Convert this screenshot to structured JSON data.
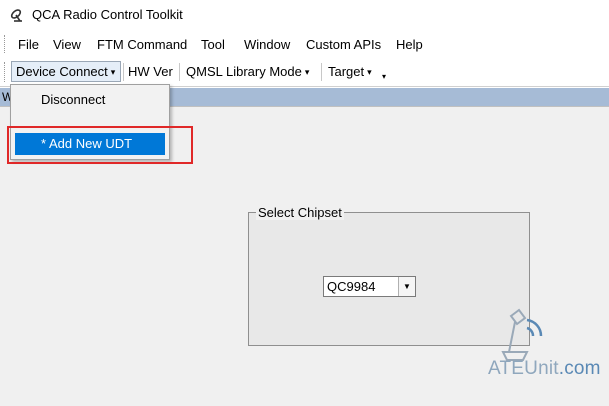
{
  "window": {
    "title": "QCA Radio Control Toolkit",
    "icon": "satellite-dish-icon"
  },
  "menubar": {
    "items": [
      "File",
      "View",
      "FTM Command",
      "Tool",
      "Window",
      "Custom APIs",
      "Help"
    ]
  },
  "toolbar": {
    "device_connect": "Device Connect",
    "hw_ver": "HW Ver",
    "qmsl_library_mode": "QMSL Library Mode",
    "target": "Target",
    "dropdown_arrow": "▾",
    "overflow_arrow": "▾"
  },
  "mdi": {
    "child_title_fragment": "W"
  },
  "device_menu": {
    "items": [
      {
        "label": "Disconnect",
        "highlighted": false
      },
      {
        "label": "* Add New UDT",
        "highlighted": true
      }
    ]
  },
  "chipset": {
    "group_label": "Select Chipset",
    "selected": "QC9984",
    "combo_arrow": "▼"
  },
  "watermark": {
    "text_main": "ATEUnit",
    "text_suffix": ".com"
  },
  "colors": {
    "highlight": "#0078d7",
    "annotation": "#e02828",
    "mdi_bar": "#a6bbd6"
  }
}
